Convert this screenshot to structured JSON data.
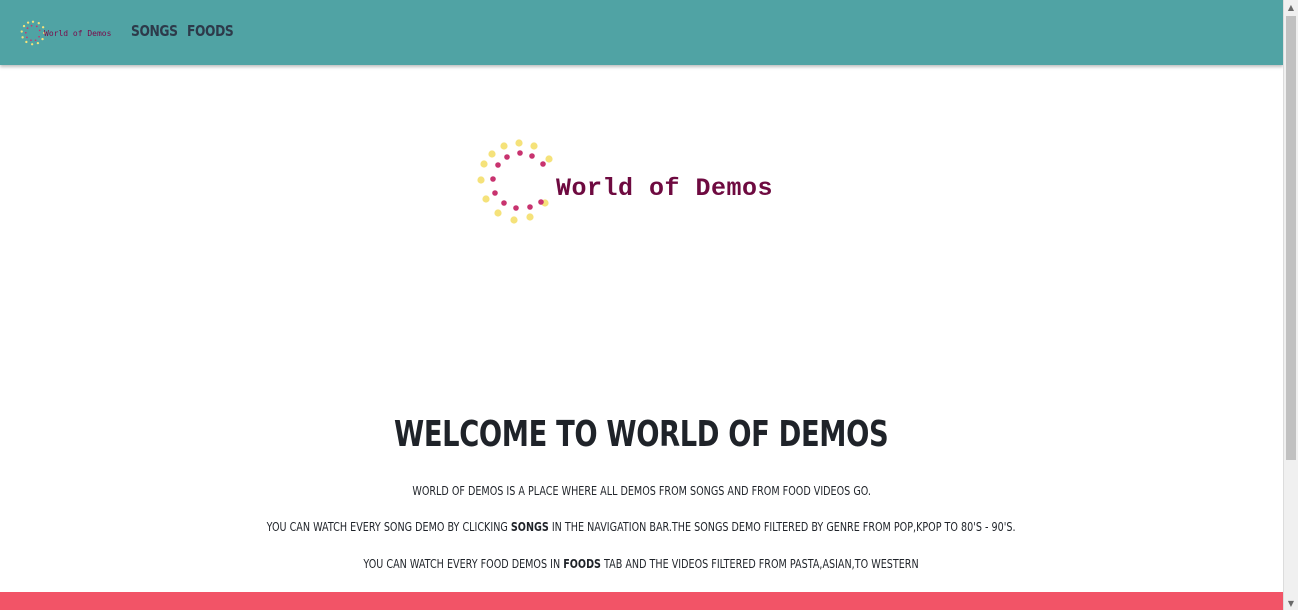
{
  "navbar": {
    "brand_text": "World of Demos",
    "links": [
      "SONGS",
      "FOODS"
    ]
  },
  "hero": {
    "logo_text": "World of Demos"
  },
  "main": {
    "title": "WELCOME TO WORLD OF DEMOS",
    "p1": "WORLD OF DEMOS IS A PLACE WHERE ALL DEMOS FROM SONGS AND FROM FOOD VIDEOS GO.",
    "p2": {
      "before": "YOU CAN WATCH EVERY SONG DEMO BY CLICKING ",
      "bold": "SONGS",
      "after": " IN THE NAVIGATION BAR.THE SONGS DEMO FILTERED BY GENRE FROM POP,KPOP TO 80'S - 90'S."
    },
    "p3": {
      "before": "YOU CAN WATCH EVERY FOOD DEMOS IN ",
      "bold": "FOODS",
      "after": " TAB AND THE VIDEOS FILTERED FROM PASTA,ASIAN,TO WESTERN"
    }
  },
  "colors": {
    "navbar_bg": "#50a3a4",
    "footer_bg": "#f25467",
    "logo_text": "#6e0a40",
    "dots_yellow": "#f5e27a",
    "dots_pink": "#c8336f"
  },
  "icons": {
    "brand_logo": "dotted-circle-logo-icon",
    "scroll_up": "scroll-up-arrow-icon",
    "scroll_down": "scroll-down-arrow-icon"
  }
}
